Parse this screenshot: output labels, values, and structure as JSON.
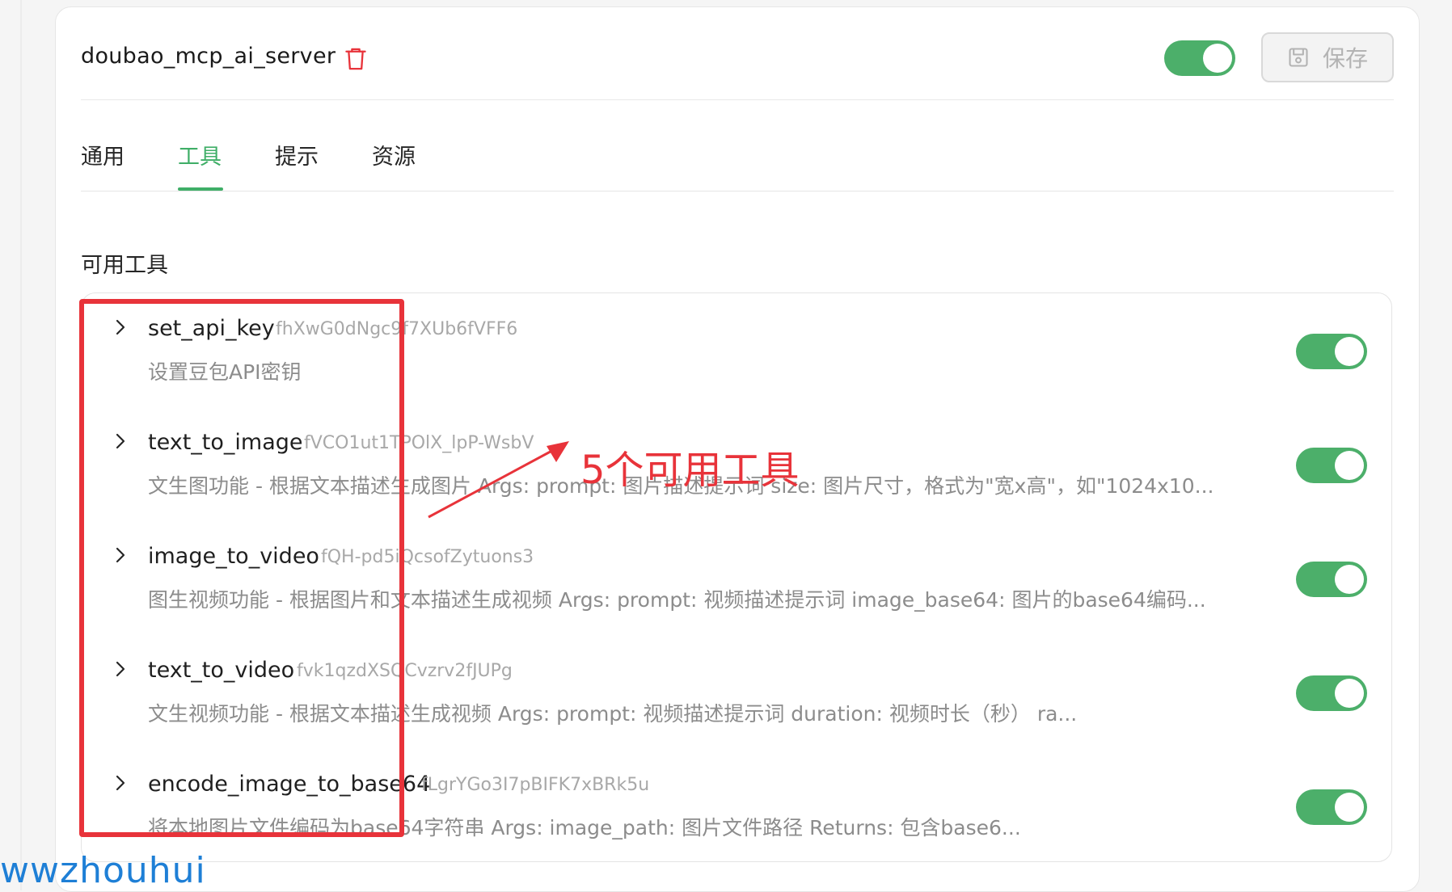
{
  "header": {
    "server_name": "doubao_mcp_ai_server",
    "save_label": "保存",
    "enabled": true
  },
  "tabs": [
    {
      "label": "通用",
      "active": false
    },
    {
      "label": "工具",
      "active": true
    },
    {
      "label": "提示",
      "active": false
    },
    {
      "label": "资源",
      "active": false
    }
  ],
  "section_title": "可用工具",
  "tools": [
    {
      "name": "set_api_key",
      "id": "fhXwG0dNgc9f7XUb6fVFF6",
      "description": "设置豆包API密钥",
      "enabled": true
    },
    {
      "name": "text_to_image",
      "id": "fVCO1ut1TPOlX_lpP-WsbV",
      "description": "文生图功能 - 根据文本描述生成图片 Args: prompt: 图片描述提示词 size: 图片尺寸，格式为\"宽x高\"，如\"1024x10...",
      "enabled": true
    },
    {
      "name": "image_to_video",
      "id": "fQH-pd5iQcsofZytuons3",
      "description": "图生视频功能 - 根据图片和文本描述生成视频 Args: prompt: 视频描述提示词 image_base64: 图片的base64编码...",
      "enabled": true
    },
    {
      "name": "text_to_video",
      "id": "fvk1qzdXSQCvzrv2fJUPg",
      "description": "文生视频功能 - 根据文本描述生成视频 Args: prompt: 视频描述提示词 duration: 视频时长（秒） ra...",
      "enabled": true
    },
    {
      "name": "encode_image_to_base64",
      "id": "fLgrYGo3I7pBIFK7xBRk5u",
      "description": "将本地图片文件编码为base64字符串 Args: image_path: 图片文件路径 Returns: 包含base6...",
      "enabled": true
    }
  ],
  "annotation": {
    "text": "5个可用工具",
    "color": "#e8333a"
  },
  "watermark": "wwzhouhui",
  "colors": {
    "accent": "#3fae67",
    "toggle_on": "#4caf6a",
    "muted_text": "#8c8c8c"
  },
  "icons": [
    "trash-icon",
    "save-icon",
    "chevron-right-icon"
  ]
}
